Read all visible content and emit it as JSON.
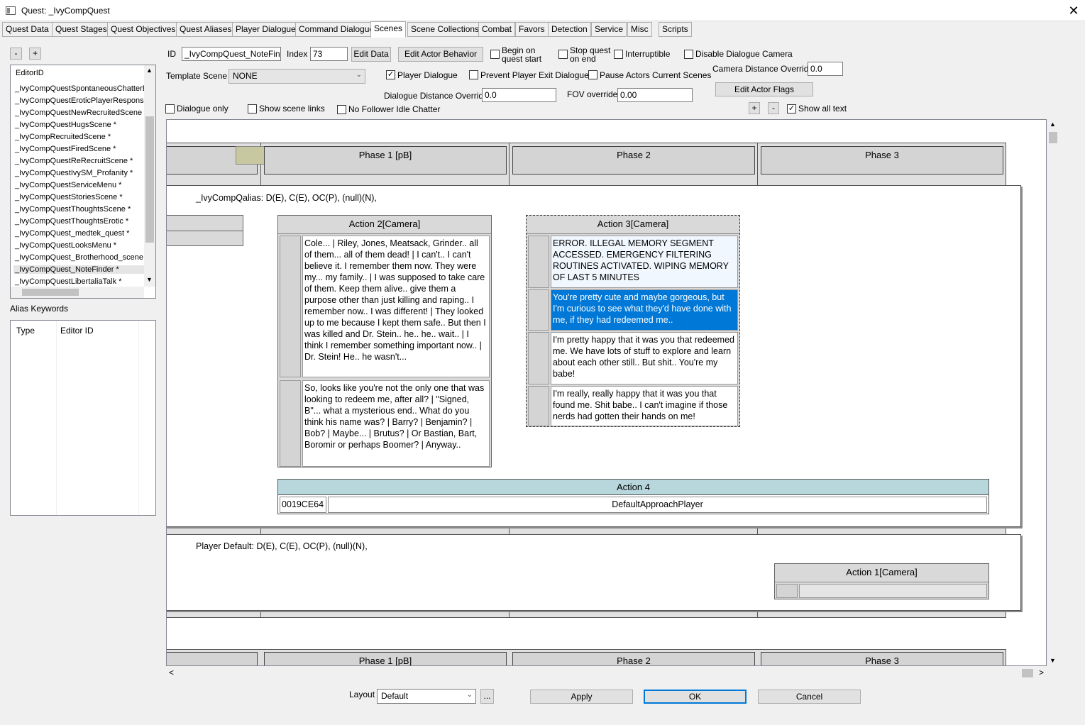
{
  "window": {
    "title": "Quest: _IvyCompQuest",
    "close_symbol": "✕"
  },
  "tabs": [
    "Quest Data",
    "Quest Stages",
    "Quest Objectives",
    "Quest Aliases",
    "Player Dialogue",
    "Command Dialogue",
    "Scenes",
    "Scene Collections",
    "Combat",
    "Favors",
    "Detection",
    "Service",
    "Misc",
    "Scripts"
  ],
  "left": {
    "minus": "-",
    "plus": "+",
    "list_header": "EditorID",
    "items": [
      "_IvyCompQuestSpontaneousChatterE",
      "_IvyCompQuestEroticPlayerResponse",
      "_IvyCompQuestNewRecruitedScene *",
      "_IvyCompQuestHugsScene *",
      "_IvyCompRecruitedScene *",
      "_IvyCompQuestFiredScene *",
      "_IvyCompQuestReRecruitScene *",
      "_IvyCompQuestIvySM_Profanity *",
      "_IvyCompQuestServiceMenu *",
      "_IvyCompQuestStoriesScene *",
      "_IvyCompQuestThoughtsScene *",
      "_IvyCompQuestThoughtsErotic *",
      "_IvyCompQuest_medtek_quest *",
      "_IvyCompQuestLooksMenu *",
      "_IvyCompQuest_Brotherhood_scene *",
      "_IvyCompQuest_NoteFinder *",
      "_IvyCompQuestLibertaliaTalk *"
    ],
    "alias_label": "Alias Keywords",
    "alias_cols": [
      "Type",
      "Editor ID"
    ]
  },
  "form": {
    "id_label": "ID",
    "id_value": "_IvyCompQuest_NoteFinder",
    "index_label": "Index",
    "index_value": "73",
    "edit_data": "Edit Data",
    "edit_actor_behavior": "Edit Actor Behavior",
    "begin_on_quest_start_1": "Begin on",
    "begin_on_quest_start_2": "quest start",
    "stop_quest_on_end_1": "Stop quest",
    "stop_quest_on_end_2": "on end",
    "interruptible": "Interruptible",
    "disable_dialogue_camera": "Disable Dialogue Camera",
    "template_scene_label": "Template Scene",
    "template_scene_value": "NONE",
    "player_dialogue": "Player Dialogue",
    "prevent_exit": "Prevent Player Exit Dialogue",
    "pause_actors": "Pause Actors Current Scenes",
    "camera_distance_label": "Camera Distance Override",
    "camera_distance_value": "0.0",
    "dialogue_distance_label": "Dialogue Distance Override",
    "dialogue_distance_value": "0.0",
    "fov_label": "FOV override",
    "fov_value": "0.00",
    "edit_actor_flags": "Edit Actor Flags",
    "dialogue_only": "Dialogue only",
    "show_scene_links": "Show scene links",
    "no_follower_idle": "No Follower Idle Chatter",
    "zoom_plus": "+",
    "zoom_minus": "-",
    "show_all_text": "Show all text",
    "check_mark": "✓"
  },
  "scene": {
    "phases": [
      "Phase 1 [pB]",
      "Phase 2",
      "Phase 3"
    ],
    "alias1": "_IvyCompQalias: D(E), C(E), OC(P), (null)(N),",
    "action2": {
      "title": "Action 2[Camera]",
      "lines": [
        "Cole... | Riley, Jones, Meatsack, Grinder.. all of them... all of them dead! | I can't.. I can't believe it. I remember them now. They were my... my family.. | I was supposed to take care of them. Keep them alive.. give them a purpose other than just killing and raping.. I remember now.. I was different! | They looked up to me because I kept them safe.. But then I was killed and Dr. Stein.. he.. he.. wait.. | I think I remember something important now.. | Dr. Stein! He.. he wasn't...",
        "So, looks like you're not the only one that was looking to redeem me, after all? | \"Signed, B\"... what a mysterious end.. What do you think his name was? | Barry? | Benjamin? | Bob? | Maybe... | Brutus? | Or Bastian, Bart, Boromir or perhaps Boomer? | Anyway.."
      ]
    },
    "action3": {
      "title": "Action 3[Camera]",
      "lines": [
        "ERROR. ILLEGAL MEMORY SEGMENT ACCESSED. EMERGENCY FILTERING ROUTINES ACTIVATED. WIPING MEMORY OF LAST 5 MINUTES",
        "You're pretty cute and maybe gorgeous, but I'm curious to see what they'd have done with me, if they had redeemed me..",
        "I'm pretty happy that it was you that redeemed me. We have lots of stuff to explore and learn about each other still.. But shit.. You're my babe!",
        "I'm really, really happy that it was you that found me. Shit babe.. I can't imagine if those nerds had gotten their hands on me!"
      ]
    },
    "action4": {
      "title": "Action 4",
      "form_id": "0019CE64",
      "package": "DefaultApproachPlayer"
    },
    "alias2": "Player Default: D(E), C(E), OC(P), (null)(N),",
    "action1": {
      "title": "Action 1[Camera]"
    },
    "phases2": [
      "Phase 1 [pB]",
      "Phase 2",
      "Phase 3"
    ]
  },
  "bottom": {
    "layout_label": "Layout",
    "layout_value": "Default",
    "ellipsis": "...",
    "apply": "Apply",
    "ok": "OK",
    "cancel": "Cancel"
  },
  "arrows": {
    "up": "▲",
    "down": "▼",
    "left": "<",
    "right": ">",
    "combo": "⌄"
  }
}
